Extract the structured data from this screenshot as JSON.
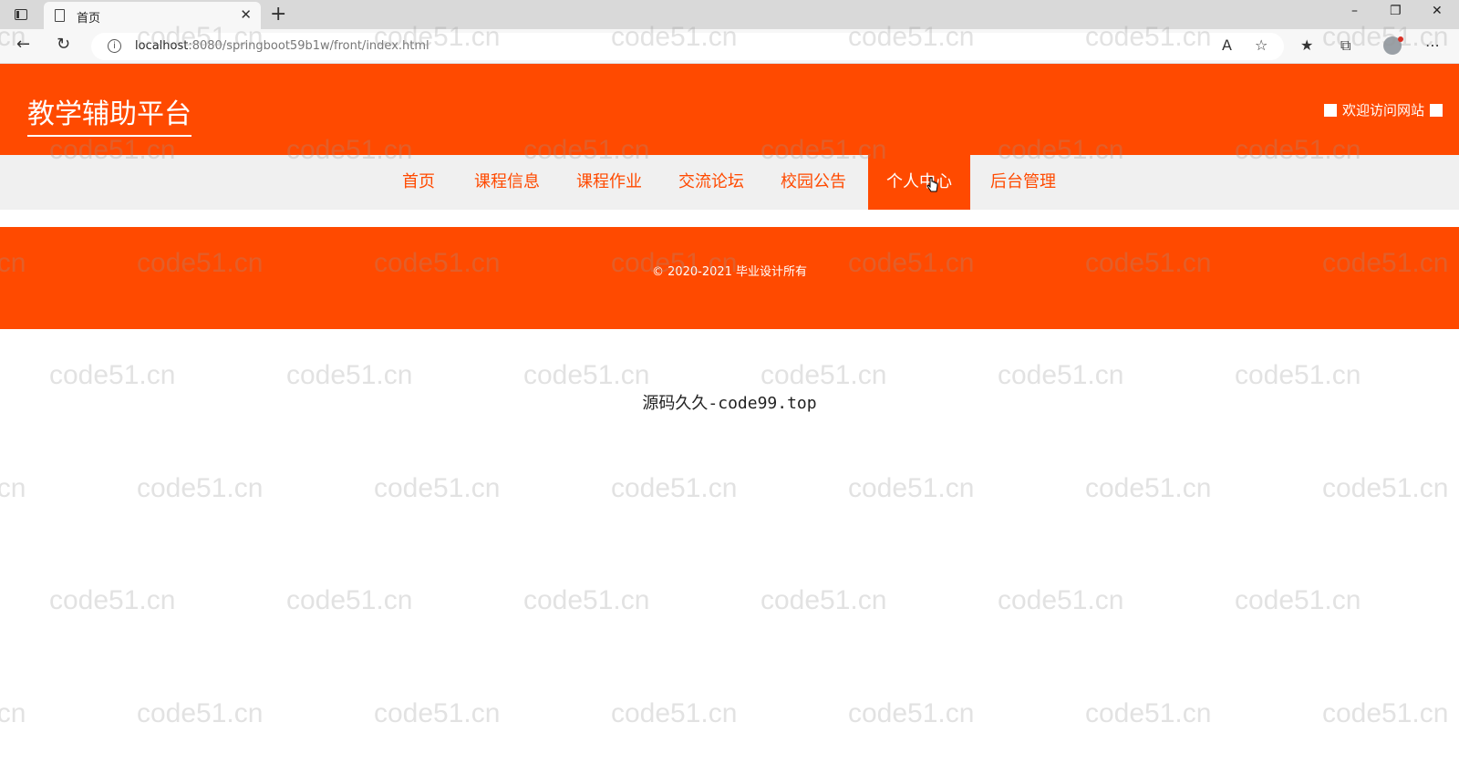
{
  "browser": {
    "tab_title": "首页",
    "tab_close": "✕",
    "new_tab": "+",
    "url_host": "localhost",
    "url_rest": ":8080/springboot59b1w/front/index.html",
    "window_controls": [
      "–",
      "❐",
      "✕"
    ]
  },
  "site": {
    "title": "教学辅助平台",
    "welcome": "欢迎访问网站"
  },
  "nav": {
    "items": [
      {
        "label": "首页",
        "active": false
      },
      {
        "label": "课程信息",
        "active": false
      },
      {
        "label": "课程作业",
        "active": false
      },
      {
        "label": "交流论坛",
        "active": false
      },
      {
        "label": "校园公告",
        "active": false
      },
      {
        "label": "个人中心",
        "active": true
      },
      {
        "label": "后台管理",
        "active": false
      }
    ]
  },
  "footer": {
    "copyright": "© 2020-2021 毕业设计所有"
  },
  "source_text": "源码久久-code99.top",
  "watermark": "code51.cn",
  "colors": {
    "brand": "#ff4a00",
    "nav_bg": "#f0f0f0"
  }
}
